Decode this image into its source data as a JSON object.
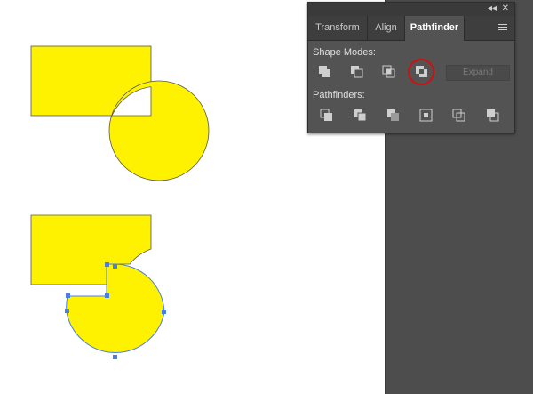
{
  "panel": {
    "collapse_label": "◂◂",
    "close_label": "✕",
    "tabs": [
      {
        "label": "Transform"
      },
      {
        "label": "Align"
      },
      {
        "label": "Pathfinder"
      }
    ],
    "shape_modes_label": "Shape Modes:",
    "pathfinders_label": "Pathfinders:",
    "expand_label": "Expand",
    "shape_mode_icons": [
      "unite-icon",
      "minus-front-icon",
      "intersect-icon",
      "exclude-icon"
    ],
    "pathfinder_icons": [
      "divide-icon",
      "trim-icon",
      "merge-icon",
      "crop-icon",
      "outline-icon",
      "minus-back-icon"
    ],
    "highlighted_button": "exclude"
  },
  "colors": {
    "shape_fill": "#fff200",
    "selection": "#4a7fe0",
    "highlight": "#d01010"
  }
}
